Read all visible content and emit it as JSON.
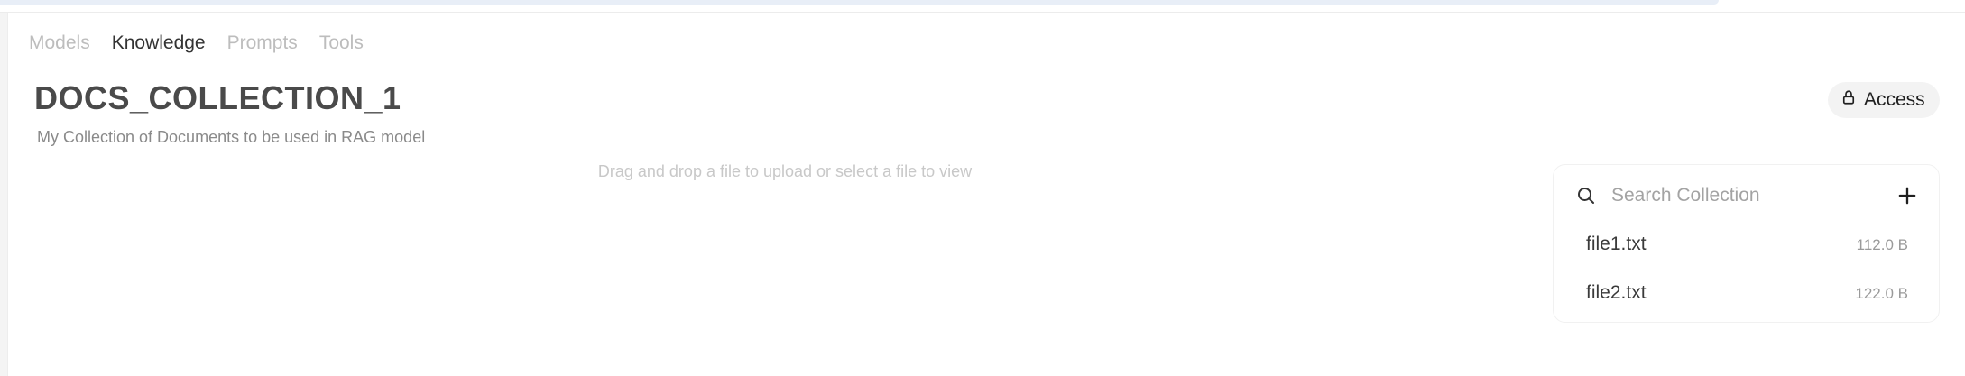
{
  "tabs": [
    {
      "label": "Models"
    },
    {
      "label": "Knowledge"
    },
    {
      "label": "Prompts"
    },
    {
      "label": "Tools"
    }
  ],
  "active_tab": "Knowledge",
  "collection": {
    "title": "DOCS_COLLECTION_1",
    "description": "My Collection of Documents to be used in RAG model"
  },
  "access_button": {
    "label": "Access",
    "icon": "lock-icon"
  },
  "dropzone_text": "Drag and drop a file to upload or select a file to view",
  "search": {
    "placeholder": "Search Collection",
    "value": ""
  },
  "files": [
    {
      "name": "file1.txt",
      "size": "112.0 B"
    },
    {
      "name": "file2.txt",
      "size": "122.0 B"
    }
  ],
  "colors": {
    "tab_inactive": "#bdbdbd",
    "tab_active": "#333333",
    "title": "#4a4a4a",
    "muted": "#8a8a8a"
  }
}
